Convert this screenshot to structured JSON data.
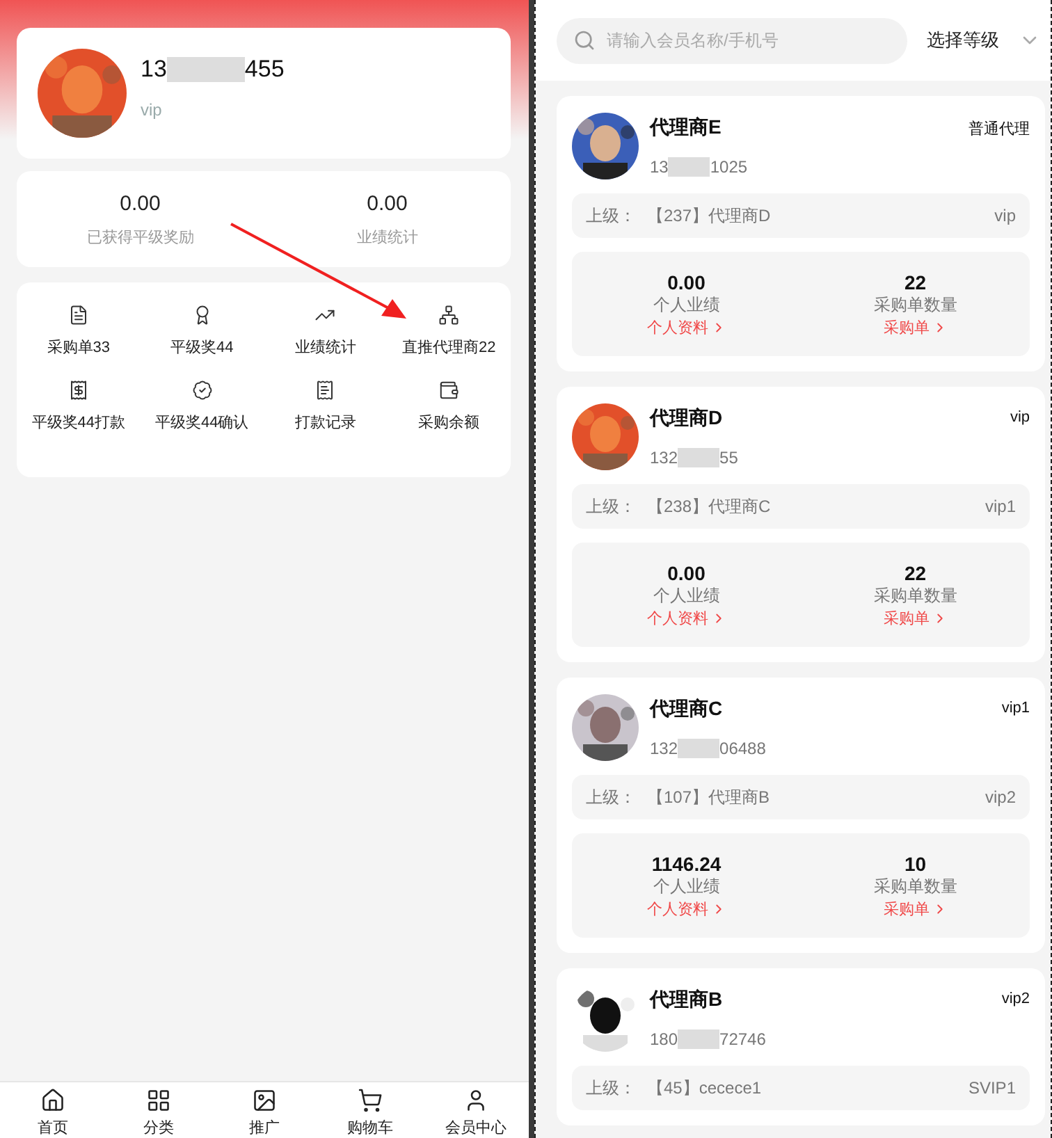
{
  "profile": {
    "phone_start": "13",
    "phone_end": "455",
    "level": "vip"
  },
  "stats": [
    {
      "value": "0.00",
      "label": "已获得平级奖励"
    },
    {
      "value": "0.00",
      "label": "业绩统计"
    }
  ],
  "menu": [
    {
      "label": "采购单33"
    },
    {
      "label": "平级奖44"
    },
    {
      "label": "业绩统计"
    },
    {
      "label": "直推代理商22"
    },
    {
      "label": "平级奖44打款"
    },
    {
      "label": "平级奖44确认"
    },
    {
      "label": "打款记录"
    },
    {
      "label": "采购余额"
    }
  ],
  "tabbar": [
    {
      "label": "首页"
    },
    {
      "label": "分类"
    },
    {
      "label": "推广"
    },
    {
      "label": "购物车"
    },
    {
      "label": "会员中心"
    }
  ],
  "search": {
    "placeholder": "请输入会员名称/手机号",
    "filter": "选择等级"
  },
  "members": [
    {
      "name": "代理商E",
      "phone_start": "13",
      "phone_end": "1025",
      "tag": "普通代理",
      "parent_label": "上级：",
      "parent": "【237】代理商D",
      "parent_level": "vip",
      "performance": "0.00",
      "performance_label": "个人业绩",
      "profile_link": "个人资料",
      "orders": "22",
      "orders_label": "采购单数量",
      "orders_link": "采购单"
    },
    {
      "name": "代理商D",
      "phone_start": "132",
      "phone_end": "55",
      "tag": "vip",
      "parent_label": "上级：",
      "parent": "【238】代理商C",
      "parent_level": "vip1",
      "performance": "0.00",
      "performance_label": "个人业绩",
      "profile_link": "个人资料",
      "orders": "22",
      "orders_label": "采购单数量",
      "orders_link": "采购单"
    },
    {
      "name": "代理商C",
      "phone_start": "132",
      "phone_end": "06488",
      "tag": "vip1",
      "parent_label": "上级：",
      "parent": "【107】代理商B",
      "parent_level": "vip2",
      "performance": "1146.24",
      "performance_label": "个人业绩",
      "profile_link": "个人资料",
      "orders": "10",
      "orders_label": "采购单数量",
      "orders_link": "采购单"
    },
    {
      "name": "代理商B",
      "phone_start": "180",
      "phone_end": "72746",
      "tag": "vip2",
      "parent_label": "上级：",
      "parent": "【45】cecece1",
      "parent_level": "SVIP1"
    }
  ]
}
